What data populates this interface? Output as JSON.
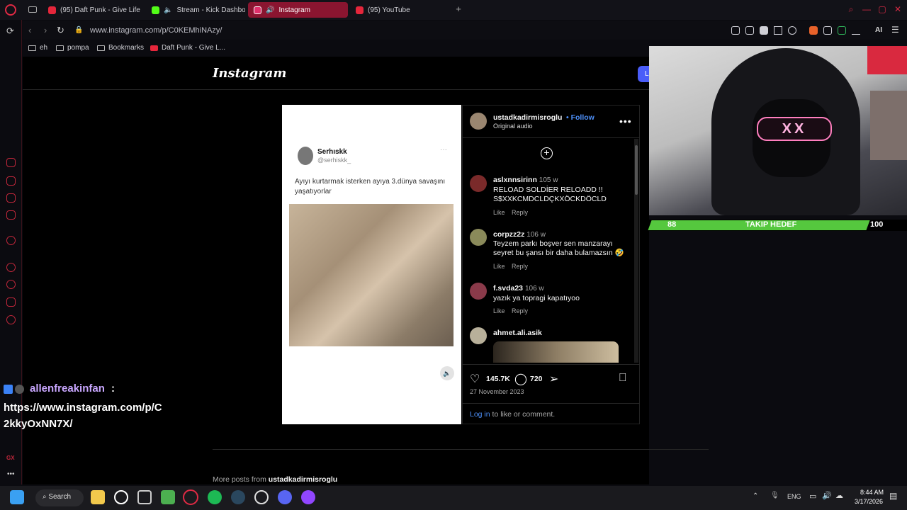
{
  "browser": {
    "tabs": [
      {
        "label": "(95) Daft Punk - Give Life",
        "fav_color": "#e5263b"
      },
      {
        "label": "Stream - Kick Dashboa",
        "fav_color": "#53fc18"
      },
      {
        "label": "Instagram",
        "fav_color": "#e1306c"
      },
      {
        "label": "(95) YouTube",
        "fav_color": "#e5263b"
      }
    ],
    "new_tab": "+",
    "url": "www.instagram.com/p/C0KEMhiNAzy/",
    "bookmarks": [
      "eh",
      "pompa",
      "Bookmarks",
      "Daft Punk - Give L..."
    ],
    "ai_label": "AI"
  },
  "instagram": {
    "logo": "Instagram",
    "login_btn": "L",
    "tweet": {
      "name": "Serhıskk",
      "handle": "@serhiskk_",
      "dots": "···",
      "text": "Ayıyı kurtarmak isterken ayıya 3.dünya savaşını yaşatıyorlar"
    },
    "post": {
      "author": "ustadkadirmisroglu",
      "follow": "• Follow",
      "audio": "Original audio",
      "more": "•••",
      "comments": [
        {
          "user": "aslxnnsirinn",
          "time": "105 w",
          "text": "RELOAD SOLDİER RELOADD !! S$XXKCMDCLDÇKXÖCKDÖCLD",
          "like": "Like",
          "reply": "Reply",
          "av": "#7a2a2a"
        },
        {
          "user": "corpzz2z",
          "time": "106 w",
          "text": "Teyzem parkı boşver sen manzarayı seyret bu şansı bir daha bulamazsın 🤣",
          "like": "Like",
          "reply": "Reply",
          "av": "#8a8a5a"
        },
        {
          "user": "f.svda23",
          "time": "106 w",
          "text": "yazık ya topragi kapatıyoo",
          "like": "Like",
          "reply": "Reply",
          "av": "#8a3a4a"
        },
        {
          "user": "ahmet.ali.asik",
          "time": "",
          "text": "",
          "like": "",
          "reply": "",
          "av": "#b8b09a"
        }
      ],
      "likes": "145.7K",
      "comment_count": "720",
      "date": "27 November 2023",
      "login_link": "Log in",
      "login_rest": " to like or comment."
    },
    "more_posts_prefix": "More posts from ",
    "more_posts_user": "ustadkadirmisroglu"
  },
  "stream": {
    "goal_start": "88",
    "goal_title": "TAKIP HEDEF",
    "goal_end": "100",
    "goal_progress": 0.88,
    "glasses_text": "XX",
    "chat_user": "allenfreakinfan",
    "chat_colon": ":",
    "chat_msg": "https://www.instagram.com/p/C2kkyOxNN7X/"
  },
  "taskbar": {
    "search": "Search",
    "lang": "ENG",
    "time": "8:44 AM",
    "date": "3/17/2026"
  },
  "sidebar_bottom": "GX"
}
